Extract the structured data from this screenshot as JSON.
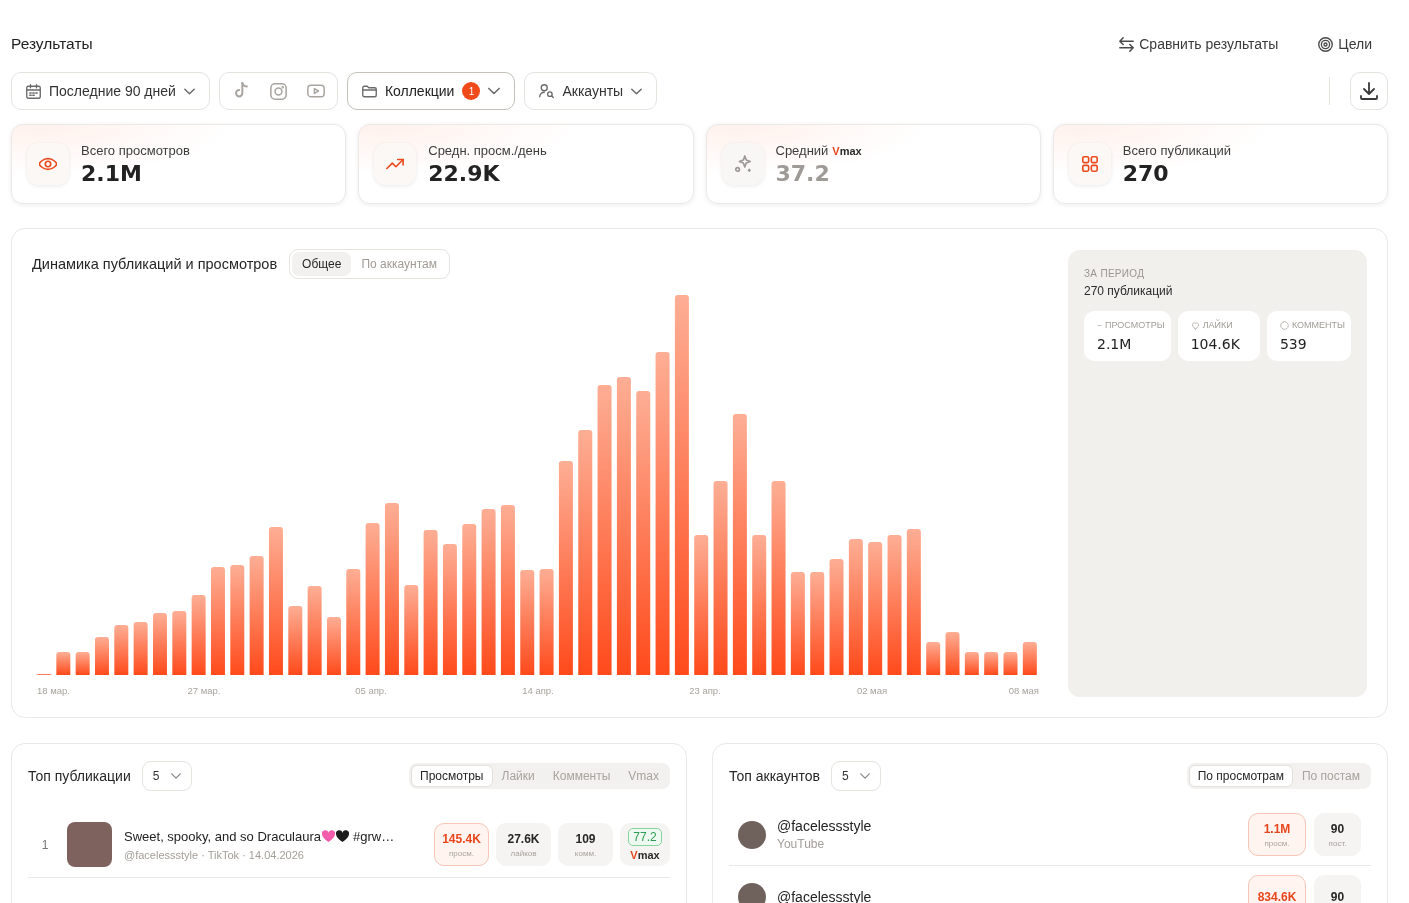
{
  "header": {
    "title": "Результаты",
    "actions": [
      {
        "label": "Сравнить результаты"
      },
      {
        "label": "Цели"
      }
    ]
  },
  "filters": {
    "period": {
      "label": "Последние 90 дней",
      "active": false
    },
    "collections": {
      "label": "Коллекции",
      "badge": "1",
      "active": true
    },
    "accounts": {
      "label": "Аккаунты",
      "active": false
    }
  },
  "stats": [
    {
      "label": "Всего просмотров",
      "value": "2.1M",
      "muted": false
    },
    {
      "label": "Средн. просм./день",
      "value": "22.9K",
      "muted": false
    },
    {
      "label": "Средний",
      "logo": "Vmax",
      "value": "37.2",
      "muted": true
    },
    {
      "label": "Всего публикаций",
      "value": "270",
      "muted": false
    }
  ],
  "dynamics": {
    "title": "Динамика публикаций и просмотров",
    "modes": [
      {
        "label": "Общее",
        "selected": true
      },
      {
        "label": "По аккаунтам",
        "selected": false
      }
    ],
    "x_labels": [
      "18 мар.",
      "27 мар.",
      "05 апр.",
      "14 апр.",
      "23 апр.",
      "02 мая",
      "08 мая"
    ],
    "summary": {
      "caption": "ЗА ПЕРИОД",
      "total": "270 публикаций",
      "metrics": [
        {
          "label": "ПРОСМОТРЫ",
          "value": "2.1M"
        },
        {
          "label": "ЛАЙКИ",
          "value": "104.6K"
        },
        {
          "label": "КОММЕНТЫ",
          "value": "539"
        }
      ]
    }
  },
  "top_posts": {
    "title": "Топ публикации",
    "limit": "5",
    "sorts": [
      {
        "label": "Просмотры",
        "selected": true
      },
      {
        "label": "Лайки",
        "selected": false
      },
      {
        "label": "Комменты",
        "selected": false
      },
      {
        "label": "Vmax",
        "selected": false
      }
    ],
    "rows": [
      {
        "rank": "1",
        "title": "Sweet, spooky, and so Draculaura",
        "title_end": "#grw…",
        "meta": "@facelessstyle · TikTok · 14.04.2026",
        "metrics": [
          {
            "value": "145.4K",
            "label": "просм.",
            "highlighted": true
          },
          {
            "value": "27.6K",
            "label": "лайков",
            "highlighted": false
          },
          {
            "value": "109",
            "label": "комм.",
            "highlighted": false
          }
        ],
        "score": "77.2",
        "score_logo": "Vmax"
      }
    ]
  },
  "top_accounts": {
    "title": "Топ аккаунтов",
    "limit": "5",
    "sorts": [
      {
        "label": "По просмотрам",
        "selected": true
      },
      {
        "label": "По постам",
        "selected": false
      }
    ],
    "rows": [
      {
        "name": "@facelessstyle",
        "platform": "YouTube",
        "metrics": [
          {
            "value": "1.1M",
            "label": "просм.",
            "highlighted": true
          },
          {
            "value": "90",
            "label": "пост.",
            "highlighted": false
          }
        ]
      },
      {
        "name": "@facelessstyle",
        "metrics": [
          {
            "value": "834.6K",
            "highlighted": true
          },
          {
            "value": "90",
            "highlighted": false
          }
        ]
      }
    ]
  }
}
